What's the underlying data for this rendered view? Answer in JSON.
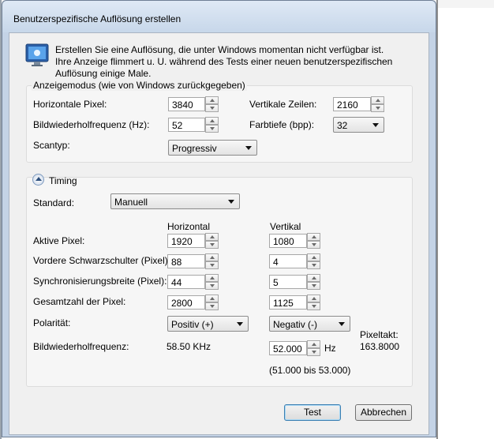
{
  "window": {
    "title": "Benutzerspezifische Auflösung erstellen"
  },
  "info": {
    "icon": "monitor-icon",
    "text": "Erstellen Sie eine Auflösung, die unter Windows momentan nicht verfügbar ist. Ihre Anzeige flimmert u. U. während des Tests einer neuen benutzerspezifischen Auflösung einige Male."
  },
  "display_mode": {
    "legend": "Anzeigemodus (wie von Windows zurückgegeben)",
    "horizontal_pixels": {
      "label": "Horizontale Pixel:",
      "value": "3840"
    },
    "vertical_lines": {
      "label": "Vertikale Zeilen:",
      "value": "2160"
    },
    "refresh_rate": {
      "label": "Bildwiederholfrequenz (Hz):",
      "value": "52"
    },
    "color_depth": {
      "label": "Farbtiefe (bpp):",
      "value": "32"
    },
    "scan_type": {
      "label": "Scantyp:",
      "value": "Progressiv"
    }
  },
  "timing": {
    "toggle_label": "Timing",
    "standard": {
      "label": "Standard:",
      "value": "Manuell"
    },
    "col_horizontal": "Horizontal",
    "col_vertical": "Vertikal",
    "active_pixels": {
      "label": "Aktive Pixel:",
      "h": "1920",
      "v": "1080"
    },
    "front_porch": {
      "label": "Vordere Schwarzschulter (Pixel):",
      "h": "88",
      "v": "4"
    },
    "sync_width": {
      "label": "Synchronisierungsbreite (Pixel):",
      "h": "44",
      "v": "5"
    },
    "total_pixels": {
      "label": "Gesamtzahl der Pixel:",
      "h": "2800",
      "v": "1125"
    },
    "polarity": {
      "label": "Polarität:",
      "h": "Positiv (+)",
      "v": "Negativ (-)"
    },
    "refresh": {
      "label": "Bildwiederholfrequenz:",
      "h_value": "58.50 KHz",
      "v_value": "52.000",
      "unit": "Hz",
      "range": "(51.000 bis 53.000)"
    },
    "pixel_clock": {
      "label": "Pixeltakt:",
      "value": "163.8000"
    }
  },
  "buttons": {
    "test": "Test",
    "cancel": "Abbrechen"
  }
}
